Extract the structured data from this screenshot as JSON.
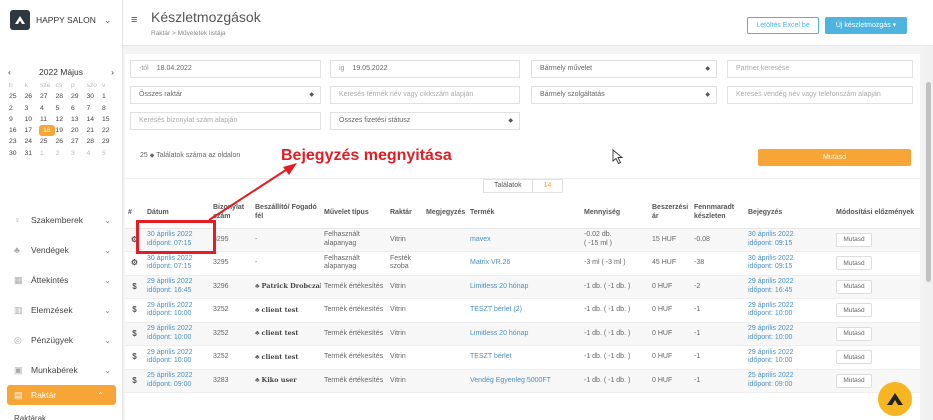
{
  "app": {
    "brand": "HAPPY SALON"
  },
  "header": {
    "title": "Készletmozgások",
    "breadcrumb": [
      "Raktár",
      ">",
      "Műveletek listája"
    ],
    "excel_btn": "Letöltés Excel be",
    "new_btn": "Új készletmozgás ▾"
  },
  "calendar": {
    "month": "2022 Május",
    "prev": "‹",
    "next": "›",
    "days": [
      {
        "t": "h",
        "c": "dow"
      },
      {
        "t": "k",
        "c": "dow"
      },
      {
        "t": "sze",
        "c": "dow"
      },
      {
        "t": "cs",
        "c": "dow"
      },
      {
        "t": "p",
        "c": "dow"
      },
      {
        "t": "szo",
        "c": "dow"
      },
      {
        "t": "v",
        "c": "dow"
      },
      {
        "t": "25",
        "c": ""
      },
      {
        "t": "26",
        "c": ""
      },
      {
        "t": "27",
        "c": ""
      },
      {
        "t": "28",
        "c": ""
      },
      {
        "t": "29",
        "c": ""
      },
      {
        "t": "30",
        "c": ""
      },
      {
        "t": "1",
        "c": ""
      },
      {
        "t": "2",
        "c": ""
      },
      {
        "t": "3",
        "c": ""
      },
      {
        "t": "4",
        "c": ""
      },
      {
        "t": "5",
        "c": ""
      },
      {
        "t": "6",
        "c": ""
      },
      {
        "t": "7",
        "c": ""
      },
      {
        "t": "8",
        "c": ""
      },
      {
        "t": "9",
        "c": ""
      },
      {
        "t": "10",
        "c": ""
      },
      {
        "t": "11",
        "c": ""
      },
      {
        "t": "12",
        "c": ""
      },
      {
        "t": "13",
        "c": ""
      },
      {
        "t": "14",
        "c": ""
      },
      {
        "t": "15",
        "c": ""
      },
      {
        "t": "16",
        "c": ""
      },
      {
        "t": "17",
        "c": ""
      },
      {
        "t": "18",
        "c": "sel"
      },
      {
        "t": "19",
        "c": ""
      },
      {
        "t": "20",
        "c": ""
      },
      {
        "t": "21",
        "c": ""
      },
      {
        "t": "22",
        "c": ""
      },
      {
        "t": "23",
        "c": ""
      },
      {
        "t": "24",
        "c": ""
      },
      {
        "t": "25",
        "c": ""
      },
      {
        "t": "26",
        "c": ""
      },
      {
        "t": "27",
        "c": ""
      },
      {
        "t": "28",
        "c": ""
      },
      {
        "t": "29",
        "c": ""
      },
      {
        "t": "30",
        "c": ""
      },
      {
        "t": "31",
        "c": ""
      },
      {
        "t": "1",
        "c": "out"
      },
      {
        "t": "2",
        "c": "out"
      },
      {
        "t": "3",
        "c": "out"
      },
      {
        "t": "4",
        "c": "out"
      },
      {
        "t": "5",
        "c": "out"
      }
    ]
  },
  "nav": [
    {
      "name": "nav-szakemberek",
      "icon": "user-icon",
      "glyph": "♀",
      "label": "Szakemberek",
      "chevron": "⌄"
    },
    {
      "name": "nav-vendegek",
      "icon": "users-icon",
      "glyph": "♣",
      "label": "Vendégek",
      "chevron": "⌄"
    },
    {
      "name": "nav-attekintes",
      "icon": "grid-icon",
      "glyph": "▦",
      "label": "Áttekintés",
      "chevron": "⌄"
    },
    {
      "name": "nav-elemzesek",
      "icon": "chart-icon",
      "glyph": "▥",
      "label": "Elemzések",
      "chevron": "⌄"
    },
    {
      "name": "nav-penzugyek",
      "icon": "coin-icon",
      "glyph": "◎",
      "label": "Pénzügyek",
      "chevron": "⌄"
    },
    {
      "name": "nav-munkaberek",
      "icon": "wallet-icon",
      "glyph": "▣",
      "label": "Munkabérek",
      "chevron": "⌄"
    }
  ],
  "nav_active": {
    "icon": "warehouse-icon",
    "glyph": "▤",
    "label": "Raktár",
    "chevron": "⌃"
  },
  "nav_sub": "Raktárak",
  "filters": {
    "from_prefix": "-tól",
    "from_value": "18.04.2022",
    "to_prefix": "ig",
    "to_value": "19.05.2022",
    "operation": "Bármely művelet",
    "partner_ph": "Partner keresése",
    "warehouse": "Összes raktár",
    "product_ph": "Keresés termék név vagy cikkszám alapján",
    "service": "Bármely szolgáltatás",
    "client_ph": "Keresés vendég név vagy telefonszám alapján",
    "receipt_ph": "Keresés bizonylat szám alapján",
    "payment": "Összes fizetési státusz",
    "per_page_value": "25",
    "per_page_label": "Találatok száma az oldalon",
    "show_btn": "Mutasd"
  },
  "results": {
    "count_label": "Találatok",
    "count": "14",
    "columns": [
      "#",
      "Dátum",
      "Bizonylat szám",
      "Beszállító/ Fogadó fél",
      "Művelet típus",
      "Raktár",
      "Megjegyzés",
      "Termék",
      "Mennyiség",
      "Beszerzési ár",
      "Fennmaradt készleten",
      "Bejegyzés",
      "Módosítási előzmények"
    ],
    "rows": [
      {
        "type": "⚙",
        "date": "30 április 2022",
        "time": "időpont: 07:15",
        "doc": "3295",
        "partner": "-",
        "op": "Felhasznált alapanyag",
        "wh": "Vitrin",
        "note": "",
        "product": "mavex",
        "qty": "-0.02 db.",
        "qty2": "( -15 ml )",
        "price": "15 HUF",
        "rem": "-0.08",
        "entry": "30 április 2022",
        "entry_time": "időpont: 09:15",
        "btn": "Mutasd"
      },
      {
        "type": "⚙",
        "date": "30 április 2022",
        "time": "időpont: 07:15",
        "doc": "3295",
        "partner": "-",
        "op": "Felhasznált alapanyag",
        "wh": "Festék szoba",
        "note": "",
        "product": "Matrix VR.26",
        "qty": "-3 ml ( -3 ml )",
        "qty2": "",
        "price": "45 HUF",
        "rem": "-38",
        "entry": "30 április 2022",
        "entry_time": "időpont: 09:15",
        "btn": "Mutasd"
      },
      {
        "type": "$",
        "date": "29 április 2022",
        "time": "időpont: 16:45",
        "doc": "3296",
        "partner": "Patrick Drobczak",
        "op": "Termék értékesítés",
        "wh": "Vitrin",
        "note": "",
        "product": "Limitless 20 hónap",
        "qty": "-1 db. ( -1 db. )",
        "qty2": "",
        "price": "0 HUF",
        "rem": "-2",
        "entry": "29 április 2022",
        "entry_time": "időpont: 16:45",
        "btn": "Mutasd"
      },
      {
        "type": "$",
        "date": "29 április 2022",
        "time": "időpont: 10:00",
        "doc": "3252",
        "partner": "client test",
        "op": "Termék értékesítés",
        "wh": "Vitrin",
        "note": "",
        "product": "TESZT bérlet (2)",
        "qty": "-1 db. ( -1 db. )",
        "qty2": "",
        "price": "0 HUF",
        "rem": "-1",
        "entry": "29 április 2022",
        "entry_time": "időpont: 10:00",
        "btn": "Mutasd"
      },
      {
        "type": "$",
        "date": "29 április 2022",
        "time": "időpont: 10:00",
        "doc": "3252",
        "partner": "client test",
        "op": "Termék értékesítés",
        "wh": "Vitrin",
        "note": "",
        "product": "Limitless 20 hónap",
        "qty": "-1 db. ( -1 db. )",
        "qty2": "",
        "price": "0 HUF",
        "rem": "-1",
        "entry": "29 április 2022",
        "entry_time": "időpont: 10:00",
        "btn": "Mutasd"
      },
      {
        "type": "$",
        "date": "29 április 2022",
        "time": "időpont: 10:00",
        "doc": "3252",
        "partner": "client test",
        "op": "Termék értékesítés",
        "wh": "Vitrin",
        "note": "",
        "product": "TESZT bérlet",
        "qty": "-1 db. ( -1 db. )",
        "qty2": "",
        "price": "0 HUF",
        "rem": "-1",
        "entry": "29 április 2022",
        "entry_time": "időpont: 10:00",
        "btn": "Mutasd"
      },
      {
        "type": "$",
        "date": "25 április 2022",
        "time": "időpont: 09:00",
        "doc": "3283",
        "partner": "Kiko user",
        "op": "Termék értékesítés",
        "wh": "Vitrin",
        "note": "",
        "product": "Vendég Egyenleg 5000FT",
        "qty": "-1 db. ( -1 db. )",
        "qty2": "",
        "price": "0 HUF",
        "rem": "-1",
        "entry": "25 április 2022",
        "entry_time": "időpont: 09:00",
        "btn": "Mutasd"
      }
    ]
  },
  "annotation": {
    "text": "Bejegyzés megnyitása",
    "color": "#e21d24"
  },
  "colors": {
    "accent": "#f7a536",
    "link": "#4a90c8",
    "primary": "#4fb3e0"
  }
}
